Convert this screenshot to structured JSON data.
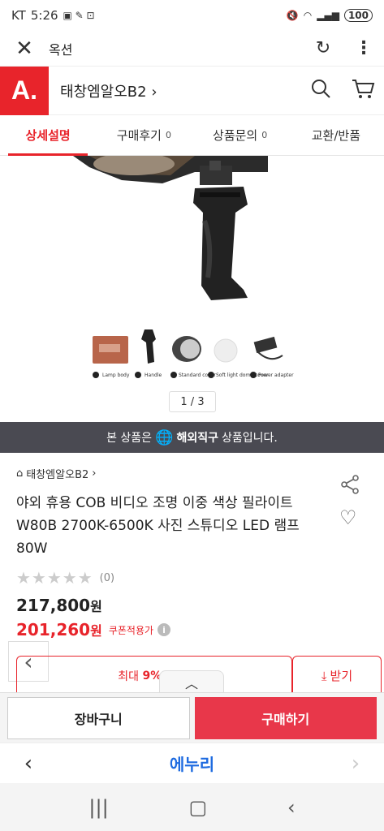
{
  "status_bar": {
    "carrier": "KT",
    "time": "5:26",
    "battery": "100"
  },
  "browser": {
    "title": "옥션"
  },
  "header": {
    "logo": "A.",
    "shop_name": "태창엠알오B2"
  },
  "tabs": [
    {
      "label": "상세설명",
      "count": ""
    },
    {
      "label": "구매후기",
      "count": "0"
    },
    {
      "label": "상품문의",
      "count": "0"
    },
    {
      "label": "교환/반품",
      "count": ""
    }
  ],
  "gallery": {
    "counter": "1 / 3",
    "thumb_labels": [
      "Lamp body",
      "Handle",
      "Standard cover",
      "Soft light dome cover",
      "Power adapter"
    ]
  },
  "notice": {
    "prefix": "본 상품은",
    "highlight": "해외직구",
    "suffix": "상품입니다."
  },
  "product": {
    "store": "태창엠알오B2",
    "title": "야외 휴용 COB 비디오 조명 이중 색상 필라이트 W80B 2700K-6500K 사진 스튜디오 LED 램프 80W",
    "review_count": "(0)",
    "price": "217,800",
    "price_unit": "원",
    "sale_price": "201,260",
    "sale_unit": "원",
    "coupon_label": "쿠폰적용가"
  },
  "discount": {
    "label": "최대",
    "value": "9%+3%",
    "download_label": "받기"
  },
  "actions": {
    "cart": "장바구니",
    "buy": "구매하기"
  },
  "bottom_nav": {
    "brand": "에누리"
  },
  "colors": {
    "accent": "#e8242b",
    "notice_bg": "#4a4a52",
    "buy_button": "#e8374a",
    "brand_blue": "#1e6be0"
  }
}
